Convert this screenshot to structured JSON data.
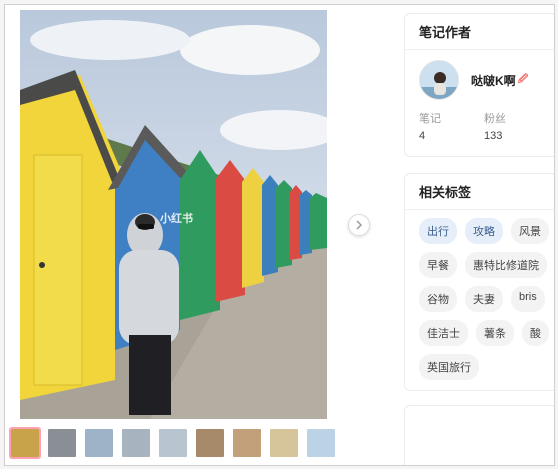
{
  "media": {
    "watermark": "小红书"
  },
  "author": {
    "title": "笔记作者",
    "name": "哒啵K啊",
    "badge": "🖉",
    "notes_label": "笔记",
    "notes_value": "4",
    "fans_label": "粉丝",
    "fans_value": "133"
  },
  "tags": {
    "title": "相关标签",
    "items": [
      {
        "label": "出行",
        "highlight": true
      },
      {
        "label": "攻略",
        "highlight": true
      },
      {
        "label": "风景",
        "highlight": false
      },
      {
        "label": "早餐",
        "highlight": false
      },
      {
        "label": "惠特比修道院",
        "highlight": false
      },
      {
        "label": "谷物",
        "highlight": false
      },
      {
        "label": "夫妻",
        "highlight": false
      },
      {
        "label": "bris",
        "highlight": false
      },
      {
        "label": "佳洁士",
        "highlight": false
      },
      {
        "label": "薯条",
        "highlight": false
      },
      {
        "label": "酸",
        "highlight": false
      },
      {
        "label": "英国旅行",
        "highlight": false
      }
    ]
  },
  "thumbnails": [
    {
      "color": "#c9a34a",
      "active": true
    },
    {
      "color": "#8a8f96",
      "active": false
    },
    {
      "color": "#9eb3c7",
      "active": false
    },
    {
      "color": "#a7b4bf",
      "active": false
    },
    {
      "color": "#b8c4cf",
      "active": false
    },
    {
      "color": "#a68a6a",
      "active": false
    },
    {
      "color": "#c2a07a",
      "active": false
    },
    {
      "color": "#d6c49a",
      "active": false
    },
    {
      "color": "#bcd3e6",
      "active": false
    }
  ]
}
